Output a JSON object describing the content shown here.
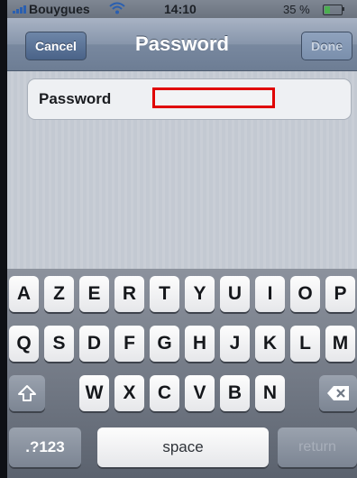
{
  "status_bar": {
    "carrier": "Bouygues",
    "time": "14:10",
    "battery": "35 %",
    "battery_level": 0.35
  },
  "nav_bar": {
    "title": "Password",
    "cancel_label": "Cancel",
    "done_label": "Done"
  },
  "form": {
    "password_label": "Password",
    "password_value": ""
  },
  "keyboard": {
    "row1": [
      "A",
      "Z",
      "E",
      "R",
      "T",
      "Y",
      "U",
      "I",
      "O",
      "P"
    ],
    "row2": [
      "Q",
      "S",
      "D",
      "F",
      "G",
      "H",
      "J",
      "K",
      "L",
      "M"
    ],
    "row3": [
      "W",
      "X",
      "C",
      "V",
      "B",
      "N"
    ],
    "numbers_label": ".?123",
    "space_label": "space",
    "return_label": "return",
    "shift_icon": "shift-arrow-icon",
    "delete_icon": "backspace-icon"
  },
  "colors": {
    "highlight_border": "#e00000",
    "nav_bar": "#7f8ea5"
  }
}
